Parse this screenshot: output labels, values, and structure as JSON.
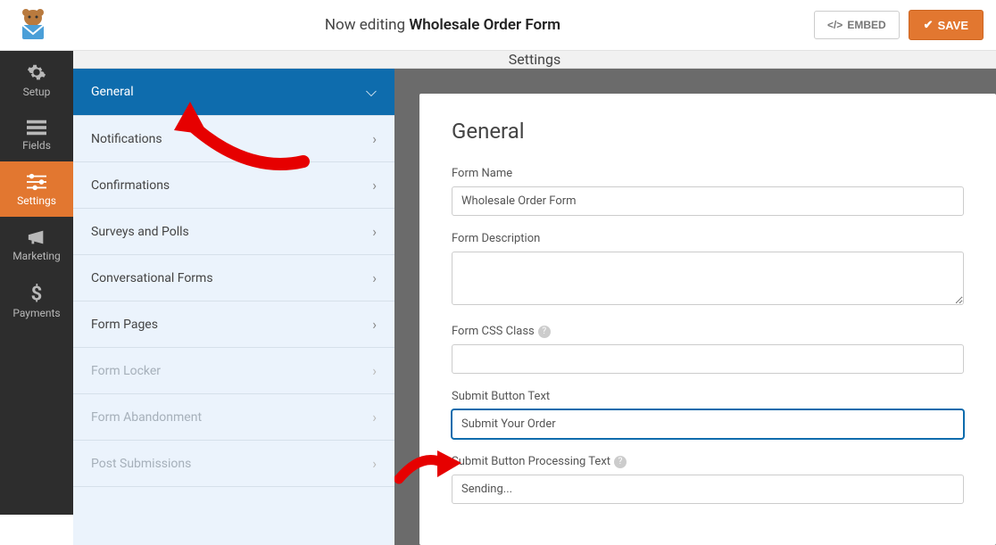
{
  "header": {
    "editing_prefix": "Now editing",
    "form_title": "Wholesale Order Form",
    "embed_label": "EMBED",
    "save_label": "SAVE"
  },
  "nav": {
    "items": [
      {
        "label": "Setup"
      },
      {
        "label": "Fields"
      },
      {
        "label": "Settings"
      },
      {
        "label": "Marketing"
      },
      {
        "label": "Payments"
      }
    ]
  },
  "content_title": "Settings",
  "sidebar": {
    "items": [
      {
        "label": "General",
        "active": true
      },
      {
        "label": "Notifications"
      },
      {
        "label": "Confirmations"
      },
      {
        "label": "Surveys and Polls"
      },
      {
        "label": "Conversational Forms"
      },
      {
        "label": "Form Pages"
      },
      {
        "label": "Form Locker",
        "disabled": true
      },
      {
        "label": "Form Abandonment",
        "disabled": true
      },
      {
        "label": "Post Submissions",
        "disabled": true
      }
    ]
  },
  "panel": {
    "heading": "General",
    "form_name_label": "Form Name",
    "form_name_value": "Wholesale Order Form",
    "form_desc_label": "Form Description",
    "form_desc_value": "",
    "css_class_label": "Form CSS Class",
    "css_class_value": "",
    "submit_text_label": "Submit Button Text",
    "submit_text_value": "Submit Your Order",
    "processing_label": "Submit Button Processing Text",
    "processing_value": "Sending..."
  }
}
